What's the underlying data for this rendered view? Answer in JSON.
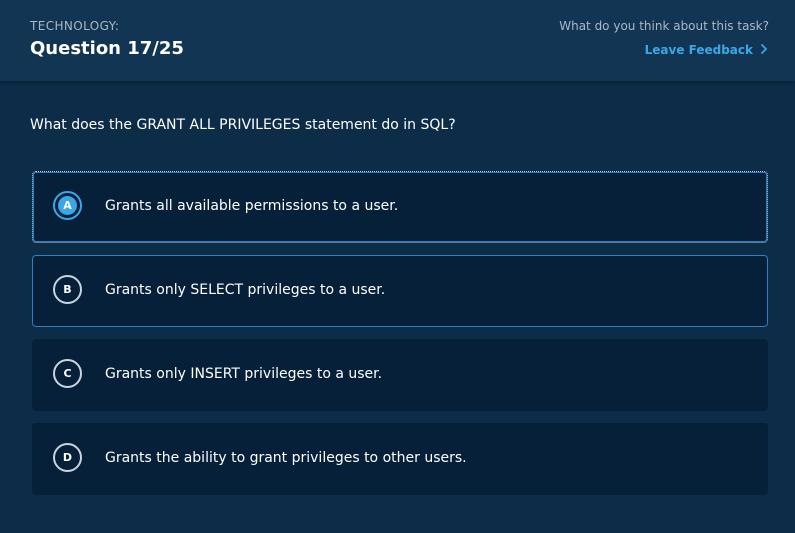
{
  "header": {
    "category": "TECHNOLOGY:",
    "question_number": "Question 17/25",
    "feedback_prompt": "What do you think about this task?",
    "feedback_link": "Leave Feedback"
  },
  "question": {
    "text": "What does the GRANT ALL PRIVILEGES statement do in SQL?"
  },
  "options": [
    {
      "letter": "A",
      "text": "Grants all available permissions to a user.",
      "state": "selected"
    },
    {
      "letter": "B",
      "text": "Grants only SELECT privileges to a user.",
      "state": "hover"
    },
    {
      "letter": "C",
      "text": "Grants only INSERT privileges to a user.",
      "state": "default"
    },
    {
      "letter": "D",
      "text": "Grants the ability to grant privileges to other users.",
      "state": "default"
    }
  ],
  "colors": {
    "background": "#0d2c48",
    "header": "#113553",
    "option_bg": "#062039",
    "accent": "#3aa8e8"
  }
}
